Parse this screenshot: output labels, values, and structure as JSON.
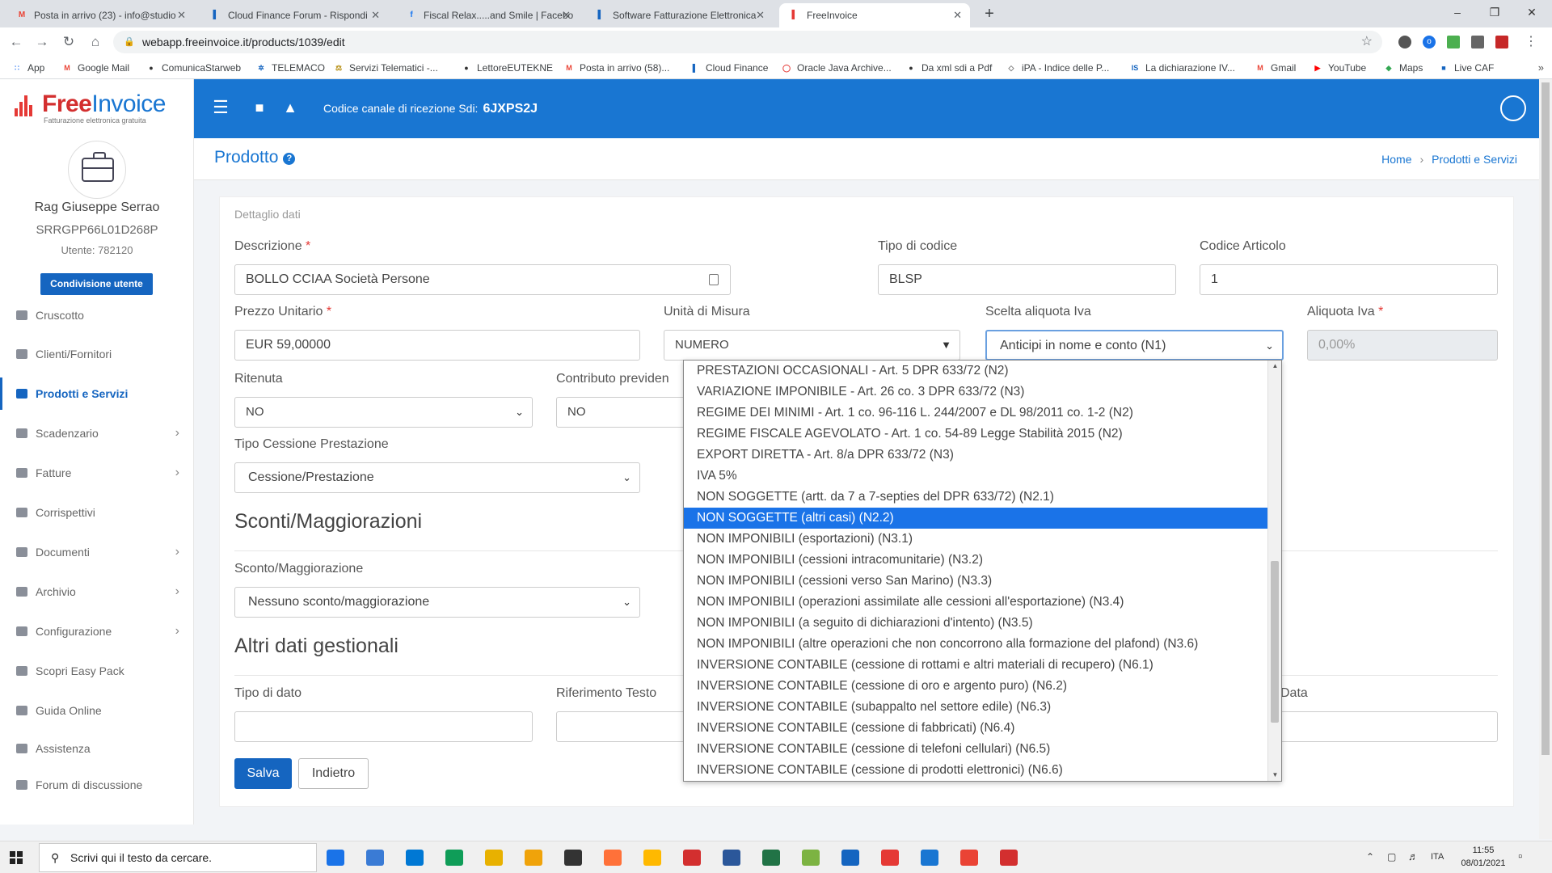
{
  "browser": {
    "tabs": [
      {
        "title": "Posta in arrivo (23) - info@studio",
        "icon": "gmail-icon",
        "color": "#ea4335",
        "glyph": "M"
      },
      {
        "title": "Cloud Finance Forum - Rispondi",
        "icon": "cloudfinance-icon",
        "color": "#1565c0",
        "glyph": "▌"
      },
      {
        "title": "Fiscal Relax.....and Smile | Facebo",
        "icon": "facebook-icon",
        "color": "#1877f2",
        "glyph": "f"
      },
      {
        "title": "Software Fatturazione Elettronica",
        "icon": "cloudfinance-icon",
        "color": "#1565c0",
        "glyph": "▌"
      },
      {
        "title": "FreeInvoice",
        "icon": "freeinvoice-icon",
        "color": "#e53935",
        "glyph": "▌"
      }
    ],
    "active_tab": 4,
    "url": "webapp.freeinvoice.it/products/1039/edit",
    "bookmarks": [
      {
        "label": "App",
        "color": "#4285f4",
        "glyph": "∷"
      },
      {
        "label": "Google Mail",
        "color": "#ea4335",
        "glyph": "M"
      },
      {
        "label": "ComunicaStarweb",
        "color": "#333",
        "glyph": "●"
      },
      {
        "label": "TELEMACO",
        "color": "#1565c0",
        "glyph": "✲"
      },
      {
        "label": "Servizi Telematici -...",
        "color": "#b28704",
        "glyph": "⚖"
      },
      {
        "label": "LettoreEUTEKNE",
        "color": "#333",
        "glyph": "●"
      },
      {
        "label": "Posta in arrivo (58)...",
        "color": "#ea4335",
        "glyph": "M"
      },
      {
        "label": "Cloud Finance",
        "color": "#1565c0",
        "glyph": "▌"
      },
      {
        "label": "Oracle Java Archive...",
        "color": "#e53935",
        "glyph": "◯"
      },
      {
        "label": "Da xml sdi a Pdf",
        "color": "#333",
        "glyph": "●"
      },
      {
        "label": "iPA - Indice delle P...",
        "color": "#777",
        "glyph": "◇"
      },
      {
        "label": "La dichiarazione IV...",
        "color": "#1565c0",
        "glyph": "IS"
      },
      {
        "label": "Gmail",
        "color": "#ea4335",
        "glyph": "M"
      },
      {
        "label": "YouTube",
        "color": "#ff0000",
        "glyph": "▶"
      },
      {
        "label": "Maps",
        "color": "#34a853",
        "glyph": "◆"
      },
      {
        "label": "Live CAF",
        "color": "#1565c0",
        "glyph": "■"
      }
    ]
  },
  "brand": {
    "name_red": "Free",
    "name_blue": "Invoice",
    "tagline": "Fatturazione elettronica gratuita"
  },
  "user": {
    "name": "Rag Giuseppe Serrao",
    "tax_code": "SRRGPP66L01D268P",
    "user_id": "Utente: 782120",
    "share_button": "Condivisione utente"
  },
  "sidebar": {
    "items": [
      {
        "label": "Cruscotto",
        "icon": "dashboard-icon",
        "chev": ""
      },
      {
        "label": "Clienti/Fornitori",
        "icon": "user-icon",
        "chev": ""
      },
      {
        "label": "Prodotti e Servizi",
        "icon": "basket-icon",
        "chev": ""
      },
      {
        "label": "Scadenzario",
        "icon": "calendar-icon",
        "chev": "›"
      },
      {
        "label": "Fatture",
        "icon": "invoice-icon",
        "chev": "›"
      },
      {
        "label": "Corrispettivi",
        "icon": "receipt-icon",
        "chev": ""
      },
      {
        "label": "Documenti",
        "icon": "document-icon",
        "chev": "›"
      },
      {
        "label": "Archivio",
        "icon": "archive-icon",
        "chev": "›"
      },
      {
        "label": "Configurazione",
        "icon": "gear-icon",
        "chev": "›"
      },
      {
        "label": "Scopri Easy Pack",
        "icon": "gift-icon",
        "chev": ""
      },
      {
        "label": "Guida Online",
        "icon": "question-icon",
        "chev": ""
      },
      {
        "label": "Assistenza",
        "icon": "lifebuoy-icon",
        "chev": ""
      },
      {
        "label": "Forum di discussione",
        "icon": "forum-icon",
        "chev": ""
      }
    ],
    "active_index": 2
  },
  "topbar": {
    "channel_label": "Codice canale di ricezione Sdi:",
    "channel_code": "6JXPS2J"
  },
  "page": {
    "title": "Prodotto",
    "breadcrumb_home": "Home",
    "breadcrumb_current": "Prodotti e Servizi"
  },
  "form": {
    "section_caption": "Dettaglio dati",
    "descrizione": {
      "label": "Descrizione",
      "value": "BOLLO CCIAA Società Persone"
    },
    "tipo_codice": {
      "label": "Tipo di codice",
      "value": "BLSP"
    },
    "codice_articolo": {
      "label": "Codice Articolo",
      "value": "1"
    },
    "prezzo_unitario": {
      "label": "Prezzo Unitario",
      "value": "EUR 59,00000"
    },
    "unita_misura": {
      "label": "Unità di Misura",
      "value": "NUMERO"
    },
    "scelta_aliquota": {
      "label": "Scelta aliquota Iva",
      "value": "Anticipi in nome e conto (N1)"
    },
    "aliquota_iva": {
      "label": "Aliquota Iva",
      "value": "0,00%"
    },
    "ritenuta": {
      "label": "Ritenuta",
      "value": "NO"
    },
    "contributo": {
      "label": "Contributo previden",
      "value": "NO"
    },
    "tipo_cessione": {
      "label": "Tipo Cessione Prestazione",
      "value": "Cessione/Prestazione"
    },
    "sconti_title": "Sconti/Maggiorazioni",
    "sconto": {
      "label": "Sconto/Maggiorazione",
      "value": "Nessuno sconto/maggiorazione"
    },
    "altri_title": "Altri dati gestionali",
    "tipo_dato": {
      "label": "Tipo di dato",
      "value": ""
    },
    "riferimento_testo": {
      "label": "Riferimento Testo",
      "value": ""
    },
    "riferimento_data": {
      "label": "Data",
      "value": ""
    },
    "save_label": "Salva",
    "back_label": "Indietro"
  },
  "dropdown": {
    "options": [
      "PRESTAZIONI OCCASIONALI - Art. 5 DPR 633/72 (N2)",
      "VARIAZIONE IMPONIBILE - Art. 26 co. 3 DPR 633/72 (N3)",
      "REGIME DEI MINIMI - Art. 1 co. 96-116 L. 244/2007 e DL 98/2011 co. 1-2 (N2)",
      "REGIME FISCALE AGEVOLATO - Art. 1 co. 54-89 Legge Stabilità 2015 (N2)",
      "EXPORT DIRETTA - Art. 8/a DPR 633/72 (N3)",
      "IVA 5%",
      "NON SOGGETTE (artt. da 7 a 7-septies del DPR 633/72) (N2.1)",
      "NON SOGGETTE (altri casi) (N2.2)",
      "NON IMPONIBILI (esportazioni) (N3.1)",
      "NON IMPONIBILI (cessioni intracomunitarie) (N3.2)",
      "NON IMPONIBILI (cessioni verso San Marino) (N3.3)",
      "NON IMPONIBILI (operazioni assimilate alle cessioni all'esportazione) (N3.4)",
      "NON IMPONIBILI (a seguito di dichiarazioni d'intento) (N3.5)",
      "NON IMPONIBILI (altre operazioni che non concorrono alla formazione del plafond) (N3.6)",
      "INVERSIONE CONTABILE (cessione di rottami e altri materiali di recupero) (N6.1)",
      "INVERSIONE CONTABILE (cessione di oro e argento puro) (N6.2)",
      "INVERSIONE CONTABILE (subappalto nel settore edile) (N6.3)",
      "INVERSIONE CONTABILE (cessione di fabbricati) (N6.4)",
      "INVERSIONE CONTABILE (cessione di telefoni cellulari) (N6.5)",
      "INVERSIONE CONTABILE (cessione di prodotti elettronici) (N6.6)"
    ],
    "highlighted_index": 7
  },
  "taskbar": {
    "search_placeholder": "Scrivi qui il testo da cercare.",
    "apps": [
      "#1a73e8",
      "#3a7bd5",
      "#0078d4",
      "#0f9d58",
      "#e8b100",
      "#f0a30a",
      "#333",
      "#ff7139",
      "#ffb900",
      "#d32f2f",
      "#2b579a",
      "#217346",
      "#7cb342",
      "#1565c0",
      "#e53935",
      "#1976d2",
      "#ea4335",
      "#d32f2f"
    ],
    "lang": "ITA",
    "time": "11:55",
    "date": "08/01/2021"
  }
}
